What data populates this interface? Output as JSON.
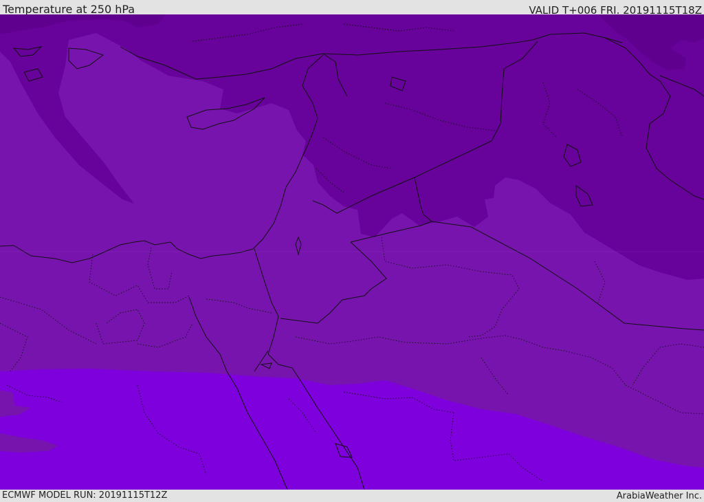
{
  "header": {
    "title": "Temperature at 250 hPa",
    "valid": "VALID T+006 FRI. 20191115T18Z"
  },
  "footer": {
    "model_run": "ECMWF MODEL RUN: 20191115T12Z",
    "credit": "ArabiaWeather Inc."
  },
  "map": {
    "field": "Temperature at 250 hPa",
    "colors": {
      "coldest": "#60008f",
      "cold": "#67029a",
      "mid": "#7714ae",
      "warm": "#7e00dc",
      "borders": "#111111"
    }
  }
}
